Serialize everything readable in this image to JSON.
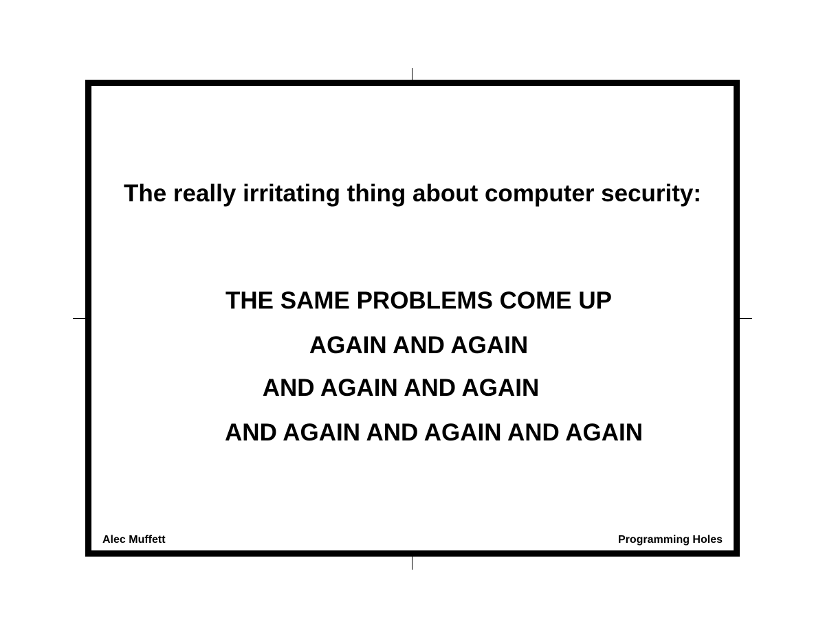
{
  "slide": {
    "headline": "The really irritating thing about computer security:",
    "lines": [
      "THE SAME PROBLEMS COME UP",
      "AGAIN AND AGAIN",
      "AND AGAIN AND AGAIN",
      "AND AGAIN AND AGAIN AND AGAIN"
    ],
    "footer": {
      "author": "Alec Muffett",
      "talk_title": "Programming Holes"
    }
  }
}
